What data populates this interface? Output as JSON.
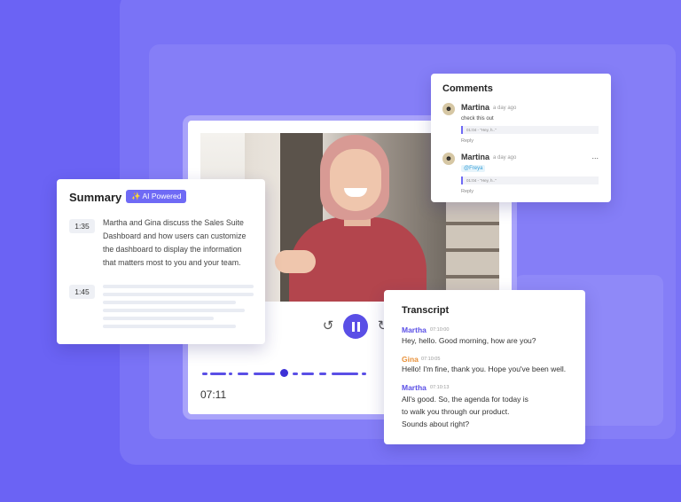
{
  "summary": {
    "title": "Summary",
    "badge_label": "AI Powered",
    "entries": [
      {
        "timestamp": "1:35",
        "lines": [
          "Martha and Gina discuss the Sales Suite",
          "Dashboard and how users can customize",
          "the dashboard to display the information",
          "that matters most to you and your team."
        ]
      },
      {
        "timestamp": "1:45"
      }
    ]
  },
  "player": {
    "current_time": "07:11",
    "rewind_icon": "rewind-icon",
    "pause_icon": "pause-icon",
    "forward_icon": "forward-icon"
  },
  "comments": {
    "title": "Comments",
    "items": [
      {
        "name": "Martina",
        "time": "a day ago",
        "text": "check this out",
        "quote": "01:04 - \"Hey, h..\"",
        "reply": "Reply"
      },
      {
        "name": "Martina",
        "time": "a day ago",
        "mention": "@Freya",
        "quote": "01:04 - \"Hey, h..\"",
        "reply": "Reply",
        "more": "..."
      }
    ]
  },
  "transcript": {
    "title": "Transcript",
    "entries": [
      {
        "speaker": "Martha",
        "color": "#5a4fe6",
        "time": "07:10:00",
        "lines": [
          "Hey, hello. Good morning, how are you?"
        ]
      },
      {
        "speaker": "Gina",
        "color": "#e8913a",
        "time": "07:10:05",
        "lines": [
          "Hello! I'm fine, thank you. Hope you've been well."
        ]
      },
      {
        "speaker": "Martha",
        "color": "#5a4fe6",
        "time": "07:10:13",
        "lines": [
          "All's good. So, the agenda for today is",
          "to walk you through our product.",
          "Sounds about right?"
        ]
      }
    ]
  },
  "colors": {
    "background": "#6b63f4",
    "accent": "#5a4fe6",
    "badge": "#6f6af5",
    "gina": "#e8913a"
  }
}
